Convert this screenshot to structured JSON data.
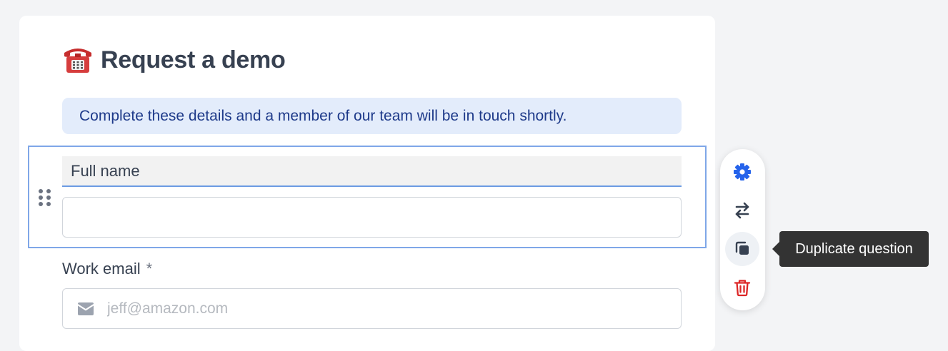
{
  "form": {
    "title": "Request a demo",
    "title_icon": "telephone-icon",
    "banner_text": "Complete these details and a member of our team will be in touch shortly."
  },
  "questions": [
    {
      "label": "Full name",
      "value": "",
      "selected": true
    },
    {
      "label": "Work email",
      "required_marker": "*",
      "placeholder": "jeff@amazon.com",
      "icon": "envelope-icon"
    }
  ],
  "toolbar": {
    "items": [
      {
        "name": "settings",
        "icon": "gear-icon",
        "color": "#2563eb"
      },
      {
        "name": "change-type",
        "icon": "swap-arrows-icon",
        "color": "#374151"
      },
      {
        "name": "duplicate",
        "icon": "duplicate-icon",
        "color": "#374151"
      },
      {
        "name": "delete",
        "icon": "trash-icon",
        "color": "#dc2626"
      }
    ],
    "tooltip": "Duplicate question"
  },
  "colors": {
    "selection_border": "#7fa7e8",
    "banner_bg": "#e3ecfb",
    "banner_text": "#1e3a8a",
    "page_bg": "#f3f4f6"
  }
}
